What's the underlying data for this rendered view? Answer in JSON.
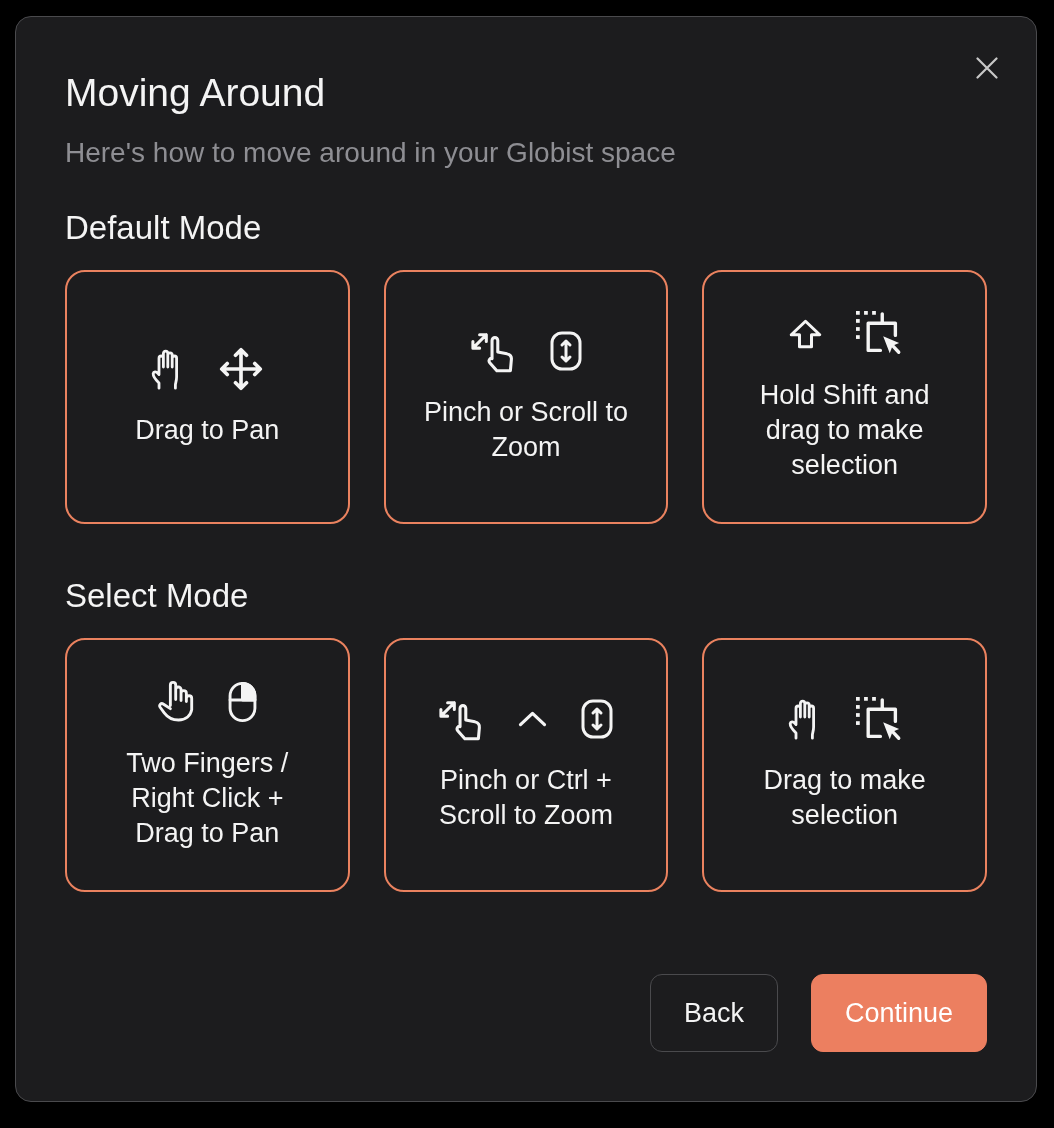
{
  "dialog": {
    "title": "Moving Around",
    "subtitle": "Here's how to move around in your Globist space"
  },
  "sections": [
    {
      "heading": "Default Mode",
      "cards": [
        {
          "icons": [
            {
              "kind": "hand"
            },
            {
              "kind": "move"
            }
          ],
          "text": "Drag to Pan"
        },
        {
          "icons": [
            {
              "kind": "pinch"
            },
            {
              "kind": "scroll"
            }
          ],
          "text": "Pinch or Scroll to Zoom"
        },
        {
          "icons": [
            {
              "kind": "shift"
            },
            {
              "kind": "select"
            }
          ],
          "text": "Hold Shift and drag to make selection"
        }
      ]
    },
    {
      "heading": "Select Mode",
      "cards": [
        {
          "icons": [
            {
              "kind": "fingers"
            },
            {
              "kind": "mouse"
            }
          ],
          "text": "Two Fingers / Right Click + Drag to Pan"
        },
        {
          "icons": [
            {
              "kind": "pinch"
            },
            {
              "kind": "caret"
            },
            {
              "kind": "scroll"
            }
          ],
          "text": "Pinch or Ctrl + Scroll to Zoom"
        },
        {
          "icons": [
            {
              "kind": "hand"
            },
            {
              "kind": "select"
            }
          ],
          "text": "Drag to make selection"
        }
      ]
    }
  ],
  "buttons": [
    {
      "label": "Back",
      "kind": "secondary"
    },
    {
      "label": "Continue",
      "kind": "primary"
    }
  ]
}
